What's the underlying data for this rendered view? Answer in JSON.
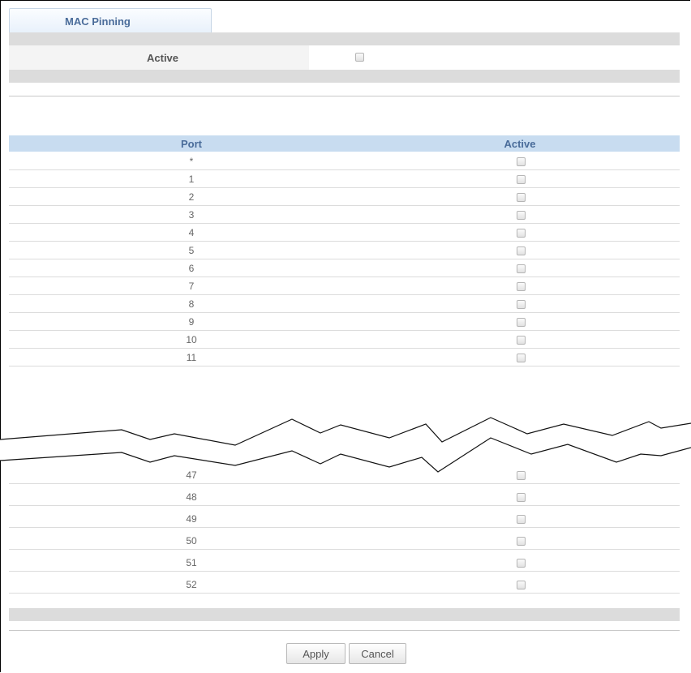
{
  "tab": {
    "label": "MAC Pinning"
  },
  "global": {
    "active_label": "Active",
    "active_checked": false
  },
  "table": {
    "headers": {
      "port": "Port",
      "active": "Active"
    },
    "rows_top": [
      {
        "port": "*",
        "active": false
      },
      {
        "port": "1",
        "active": false
      },
      {
        "port": "2",
        "active": false
      },
      {
        "port": "3",
        "active": false
      },
      {
        "port": "4",
        "active": false
      },
      {
        "port": "5",
        "active": false
      },
      {
        "port": "6",
        "active": false
      },
      {
        "port": "7",
        "active": false
      },
      {
        "port": "8",
        "active": false
      },
      {
        "port": "9",
        "active": false
      },
      {
        "port": "10",
        "active": false
      },
      {
        "port": "11",
        "active": false
      }
    ],
    "rows_bottom": [
      {
        "port": "47",
        "active": false
      },
      {
        "port": "48",
        "active": false
      },
      {
        "port": "49",
        "active": false
      },
      {
        "port": "50",
        "active": false
      },
      {
        "port": "51",
        "active": false
      },
      {
        "port": "52",
        "active": false
      }
    ]
  },
  "buttons": {
    "apply": "Apply",
    "cancel": "Cancel"
  }
}
